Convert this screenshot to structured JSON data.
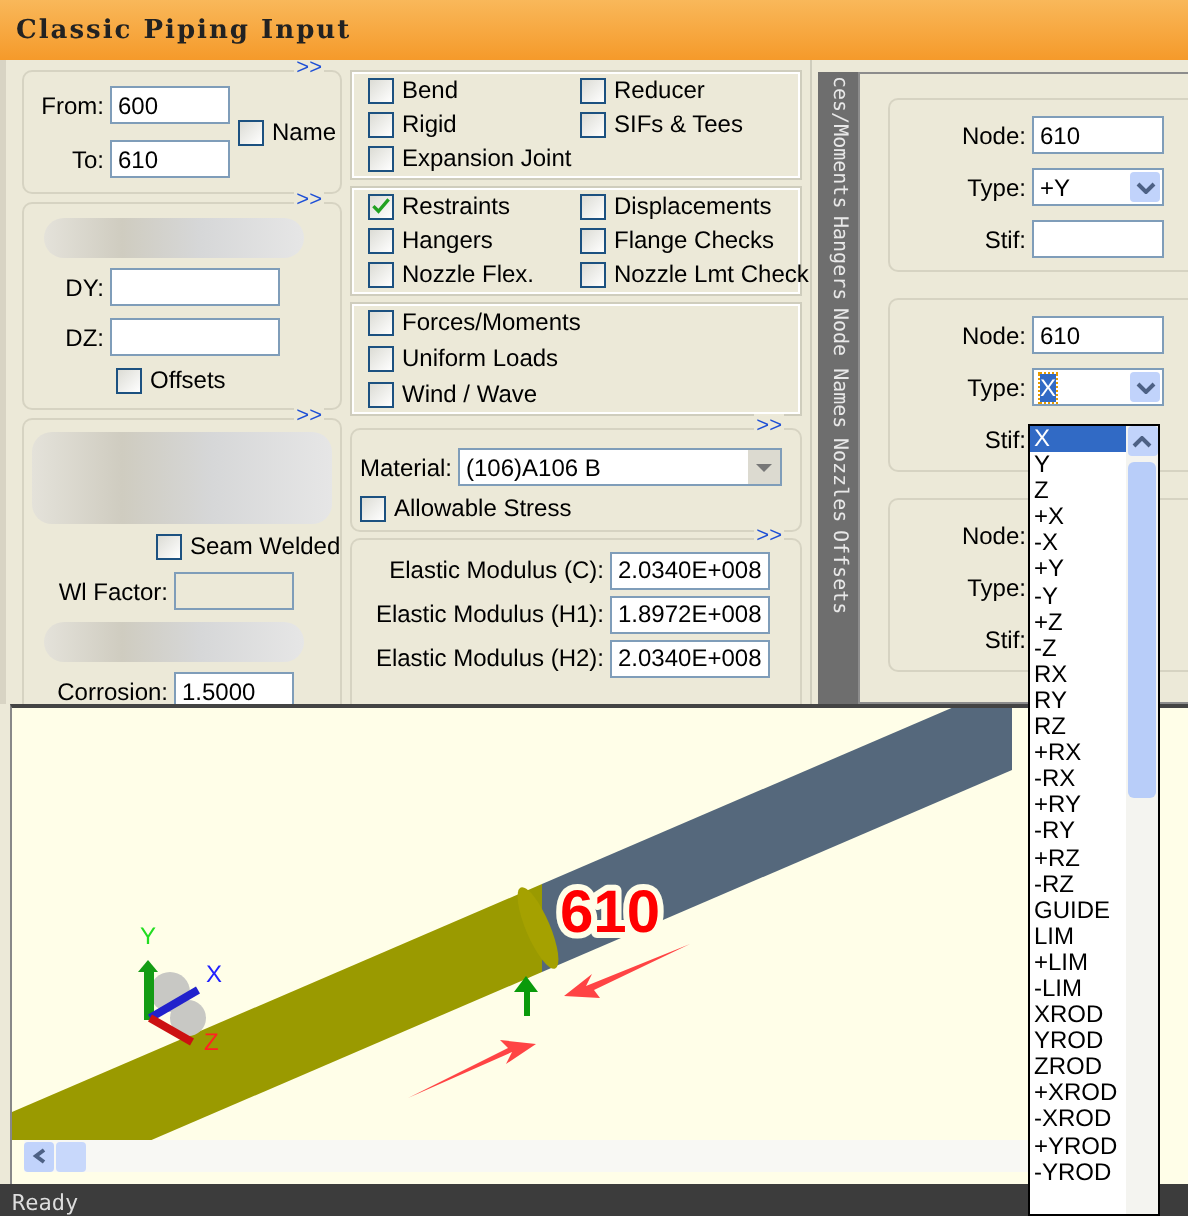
{
  "window": {
    "title": "Classic Piping Input"
  },
  "element_group": {
    "expand": ">>",
    "from": {
      "label": "From:",
      "value": "600"
    },
    "to": {
      "label": "To:",
      "value": "610"
    },
    "name_option": {
      "label": "Name",
      "checked": false
    }
  },
  "offsets_group": {
    "expand": ">>",
    "fields": [
      {
        "label": "DY:"
      },
      {
        "label": "DZ:"
      }
    ],
    "option": {
      "label": "Offsets",
      "checked": false
    }
  },
  "pipe_group": {
    "expand": ">>",
    "seam_welded": {
      "label": "Seam Welded",
      "checked": false
    },
    "wl_factor": {
      "label": "Wl Factor:",
      "disabled": true
    },
    "corrosion": {
      "label": "Corrosion:",
      "value": "1.5000"
    }
  },
  "element_options": [
    {
      "kind": "grid",
      "items": [
        {
          "label": "Bend",
          "checked": false
        },
        {
          "label": "Reducer",
          "checked": false
        },
        {
          "label": "Rigid",
          "checked": false
        },
        {
          "label": "SIFs & Tees",
          "checked": false
        },
        {
          "label": "Expansion Joint",
          "checked": false
        }
      ]
    },
    {
      "kind": "grid",
      "items": [
        {
          "label": "Restraints",
          "checked": true
        },
        {
          "label": "Displacements",
          "checked": false
        },
        {
          "label": "Hangers",
          "checked": false
        },
        {
          "label": "Flange Checks",
          "checked": false
        },
        {
          "label": "Nozzle Flex.",
          "checked": false
        },
        {
          "label": "Nozzle Lmt Check",
          "checked": false
        }
      ]
    },
    {
      "kind": "list",
      "items": [
        {
          "label": "Forces/Moments",
          "checked": false
        },
        {
          "label": "Uniform Loads",
          "checked": false
        },
        {
          "label": "Wind / Wave",
          "checked": false
        }
      ]
    }
  ],
  "material_group": {
    "expand": ">>",
    "material": {
      "label": "Material:",
      "value": "(106)A106 B"
    },
    "allowable_stress": {
      "label": "Allowable Stress",
      "checked": false
    }
  },
  "modulus_group": {
    "expand": ">>",
    "fields": [
      {
        "label": "Elastic Modulus (C):",
        "value": "2.0340E+008"
      },
      {
        "label": "Elastic Modulus (H1):",
        "value": "1.8972E+008"
      },
      {
        "label": "Elastic Modulus (H2):",
        "value": "2.0340E+008"
      }
    ]
  },
  "side_tabs": [
    {
      "label": "ces/Moments"
    },
    {
      "label": "Hangers"
    },
    {
      "label": "Node Names"
    },
    {
      "label": "Nozzles"
    },
    {
      "label": "Offsets"
    }
  ],
  "restraints": [
    {
      "rows": [
        {
          "label": "Node:",
          "field": {
            "kind": "text",
            "value": "610"
          }
        },
        {
          "label": "Type:",
          "field": {
            "kind": "select",
            "value": "+Y",
            "highlighted": false
          }
        },
        {
          "label": "Stif:",
          "field": {
            "kind": "text"
          }
        }
      ]
    },
    {
      "rows": [
        {
          "label": "Node:",
          "field": {
            "kind": "text",
            "value": "610"
          }
        },
        {
          "label": "Type:",
          "field": {
            "kind": "select",
            "value": "X",
            "highlighted": true
          }
        },
        {
          "label": "Stif:"
        }
      ]
    },
    {
      "rows": [
        {
          "label": "Node:"
        },
        {
          "label": "Type:"
        },
        {
          "label": "Stif:"
        }
      ]
    }
  ],
  "type_dropdown": {
    "options": [
      {
        "label": "X",
        "selected": true
      },
      {
        "label": "Y",
        "selected": false
      },
      {
        "label": "Z",
        "selected": false
      },
      {
        "label": "+X",
        "selected": false
      },
      {
        "label": "-X",
        "selected": false
      },
      {
        "label": "+Y",
        "selected": false
      },
      {
        "label": "-Y",
        "selected": false
      },
      {
        "label": "+Z",
        "selected": false
      },
      {
        "label": "-Z",
        "selected": false
      },
      {
        "label": "RX",
        "selected": false
      },
      {
        "label": "RY",
        "selected": false
      },
      {
        "label": "RZ",
        "selected": false
      },
      {
        "label": "+RX",
        "selected": false
      },
      {
        "label": "-RX",
        "selected": false
      },
      {
        "label": "+RY",
        "selected": false
      },
      {
        "label": "-RY",
        "selected": false
      },
      {
        "label": "+RZ",
        "selected": false
      },
      {
        "label": "-RZ",
        "selected": false
      },
      {
        "label": "GUIDE",
        "selected": false
      },
      {
        "label": "LIM",
        "selected": false
      },
      {
        "label": "+LIM",
        "selected": false
      },
      {
        "label": "-LIM",
        "selected": false
      },
      {
        "label": "XROD",
        "selected": false
      },
      {
        "label": "YROD",
        "selected": false
      },
      {
        "label": "ZROD",
        "selected": false
      },
      {
        "label": "+XROD",
        "selected": false
      },
      {
        "label": "-XROD",
        "selected": false
      },
      {
        "label": "+YROD",
        "selected": false
      },
      {
        "label": "-YROD",
        "selected": false
      }
    ]
  },
  "viewport": {
    "node_label": "610",
    "axes": [
      {
        "label": "Y"
      },
      {
        "label": "X"
      },
      {
        "label": "Z"
      }
    ]
  },
  "status_bar": {
    "text": "Ready"
  }
}
